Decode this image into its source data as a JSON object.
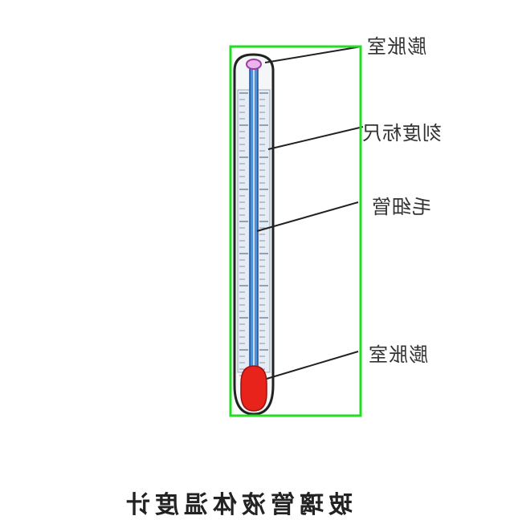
{
  "labels": {
    "top_expansion": "膨胀室",
    "scale": "刻度标尺",
    "capillary": "毛细管",
    "bulb": "膨胀室"
  },
  "caption": "玻璃管液体温度计",
  "colors": {
    "highlight_box": "#22dd22",
    "capillary_fill": "#4f8fd8",
    "bulb_fill": "#e8231c",
    "top_chamber": "#cc66cc",
    "tube_outline": "#222222"
  }
}
